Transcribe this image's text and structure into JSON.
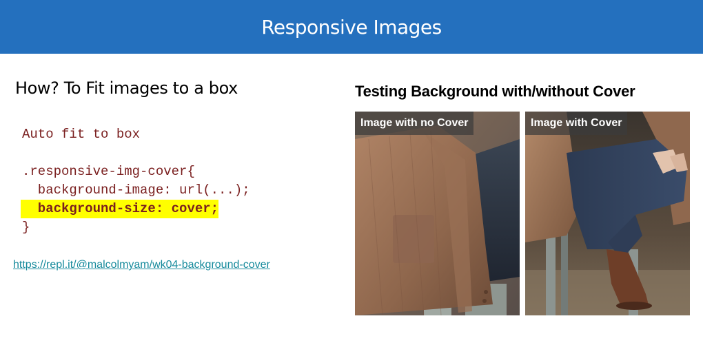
{
  "header": {
    "title": "Responsive Images"
  },
  "left": {
    "heading": "How? To Fit images to a box",
    "code": {
      "comment": "Auto fit to box",
      "selector": ".responsive-img-cover{",
      "line_bg_image": "  background-image: url(...);",
      "line_bg_size": "  background-size: cover;",
      "closing": "}"
    },
    "link": "https://repl.it/@malcolmyam/wk04-background-cover"
  },
  "right": {
    "heading": "Testing Background with/without Cover",
    "images": [
      {
        "caption": "Image with no Cover"
      },
      {
        "caption": "Image with Cover"
      }
    ]
  },
  "colors": {
    "header_bg": "#2470be",
    "code_text": "#7a1f1f",
    "highlight": "#ffff00",
    "link": "#168a9c"
  }
}
